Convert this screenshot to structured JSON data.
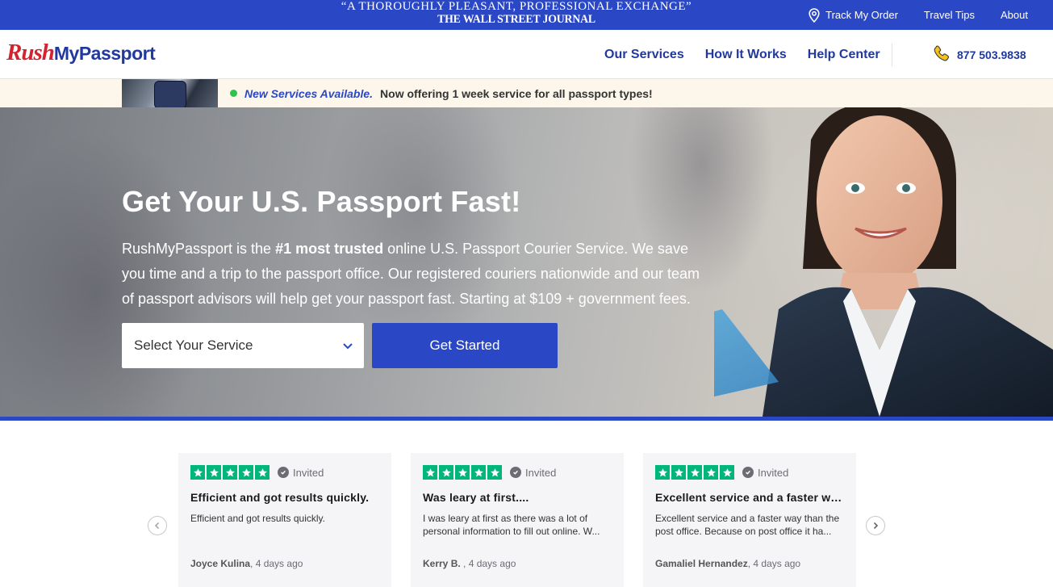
{
  "topbar": {
    "quote_line1": "“A THOROUGHLY PLEASANT, PROFESSIONAL EXCHANGE”",
    "quote_line2": "THE WALL STREET JOURNAL",
    "links": [
      {
        "label": "Track My Order",
        "icon": "location-pin-icon"
      },
      {
        "label": "Travel Tips"
      },
      {
        "label": "About"
      }
    ]
  },
  "header": {
    "logo_part1": "Rush",
    "logo_part2": "MyPassport",
    "nav": [
      "Our Services",
      "How It Works",
      "Help Center"
    ],
    "phone": "877 503.9838",
    "phone_icon": "phone-icon"
  },
  "notice": {
    "highlight": "New Services Available.",
    "message": "Now offering 1 week service for all passport types!"
  },
  "hero": {
    "title": "Get Your U.S. Passport Fast!",
    "desc_pre": "RushMyPassport is the ",
    "desc_bold": "#1 most trusted",
    "desc_post": " online U.S. Passport Courier Service. We save you time and a trip to the passport office. Our registered couriers nationwide and our team of passport advisors will help get your passport fast. Starting at $109 + government fees.",
    "select_label": "Select Your Service",
    "cta": "Get Started"
  },
  "reviews": [
    {
      "badge": "Invited",
      "title": "Efficient and got results quickly.",
      "body": "Efficient and got results quickly.",
      "author": "Joyce Kulina",
      "when": ", 4 days ago",
      "stars": 5
    },
    {
      "badge": "Invited",
      "title": "Was leary at first....",
      "body": "I was leary at first as there was a lot of personal information to fill out online. W...",
      "author": "Kerry B. ",
      "when": ", 4 days ago",
      "stars": 5
    },
    {
      "badge": "Invited",
      "title": "Excellent service and a faster way than the post office",
      "body": "Excellent service and a faster way than the post office. Because on post office it ha...",
      "author": "Gamaliel Hernandez",
      "when": ", 4 days ago",
      "stars": 5
    }
  ],
  "colors": {
    "brand_blue": "#2a47c6",
    "logo_red": "#d3232f",
    "trustpilot_green": "#00b67a"
  }
}
